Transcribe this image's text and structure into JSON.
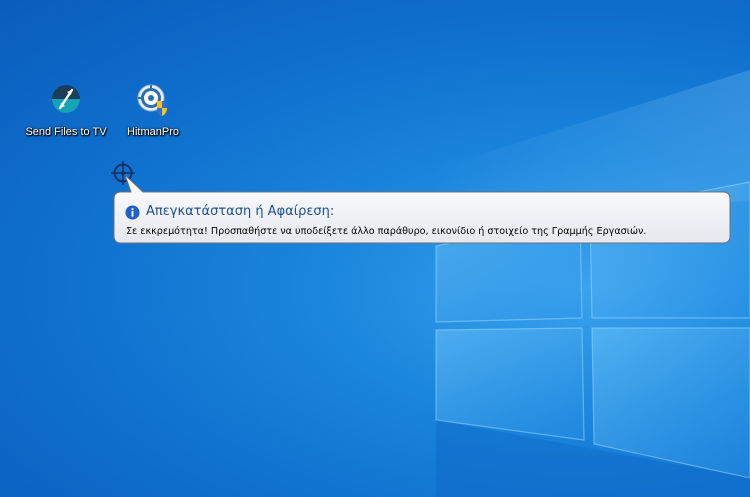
{
  "desktop": {
    "wallpaper_colors": {
      "base": "#0f6fcd",
      "glow": "#3aa3ef",
      "pane": "#4fb2f2"
    },
    "icons": [
      {
        "label": "Send Files to TV",
        "icon": "send-files-to-tv-icon"
      },
      {
        "label": "HitmanPro",
        "icon": "hitmanpro-icon"
      }
    ]
  },
  "cursor": {
    "icon": "crosshair-target-icon"
  },
  "tooltip": {
    "icon": "info-icon",
    "title": "Απεγκατάσταση ή Αφαίρεση:",
    "message": "Σε εκκρεμότητα! Προσπαθήστε να υποδείξετε άλλο παράθυρο, εικονίδιο ή στοιχείο της Γραμμής Εργασιών.",
    "title_color": "#1a4f9c"
  }
}
